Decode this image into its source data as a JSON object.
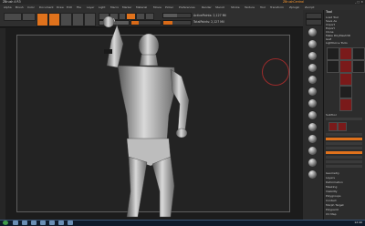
{
  "app": {
    "title": "ZBrush 4 R3",
    "ad": "ZBrushCentral",
    "window_buttons": "_ □ ×"
  },
  "menu": [
    "Alpha",
    "Brush",
    "Color",
    "Document",
    "Draw",
    "Edit",
    "File",
    "Layer",
    "Light",
    "Macro",
    "Marker",
    "Material",
    "Movie",
    "Picker",
    "Preferences",
    "Render",
    "Stencil",
    "Stroke",
    "Texture",
    "Tool",
    "Transform",
    "Zplugin",
    "Zscript"
  ],
  "toolbar": {
    "projection": "Projection Master",
    "lightbox": "LightBox",
    "edit": "Edit",
    "draw": "Draw",
    "move": "Move",
    "scale": "Scale",
    "rotate": "Rotate",
    "mrgb": "Mrgb",
    "rgb": "Rgb",
    "m": "M",
    "zadd": "Zadd",
    "zsub": "Zsub",
    "zcut": "Zcut",
    "rgb_intensity": "Rgb Intensity 100",
    "z_intensity": "Z Intensity 25",
    "focal_shift": "Focal Shift 0",
    "draw_size": "Draw Size 64",
    "active_points": "ActivePoints: 2,127 Mil",
    "total_points": "TotalPoints: 2,127 Mil",
    "rgb_intensity_value": 1.0,
    "z_intensity_value": 0.25,
    "draw_size_value": 0.32
  },
  "tray": {
    "title": "Tool",
    "load": "Load Tool",
    "save": "Save As",
    "import": "Import",
    "export": "Export",
    "clone": "Clone",
    "make": "Make PolyMesh3D",
    "goz": "GoZ",
    "all": "All",
    "visible": "Visible",
    "lightbox_tools": "Lightbox ▸ Tools",
    "tool_name": "Goblin_Body",
    "subtools": "SubTool",
    "geometry": "Geometry",
    "layers": "Layers",
    "deformation": "Deformation",
    "masking": "Masking",
    "visibility": "Visibility",
    "polygroups": "Polygroups",
    "contact": "Contact",
    "morph_target": "Morph Target",
    "polypaint": "Polypaint",
    "uv_map": "UV Map"
  },
  "taskbar": {
    "clock": "12:40"
  },
  "colors": {
    "accent": "#e0721c",
    "brush_ring": "#9a2b2b",
    "taskbar": "#0e1a2a"
  }
}
